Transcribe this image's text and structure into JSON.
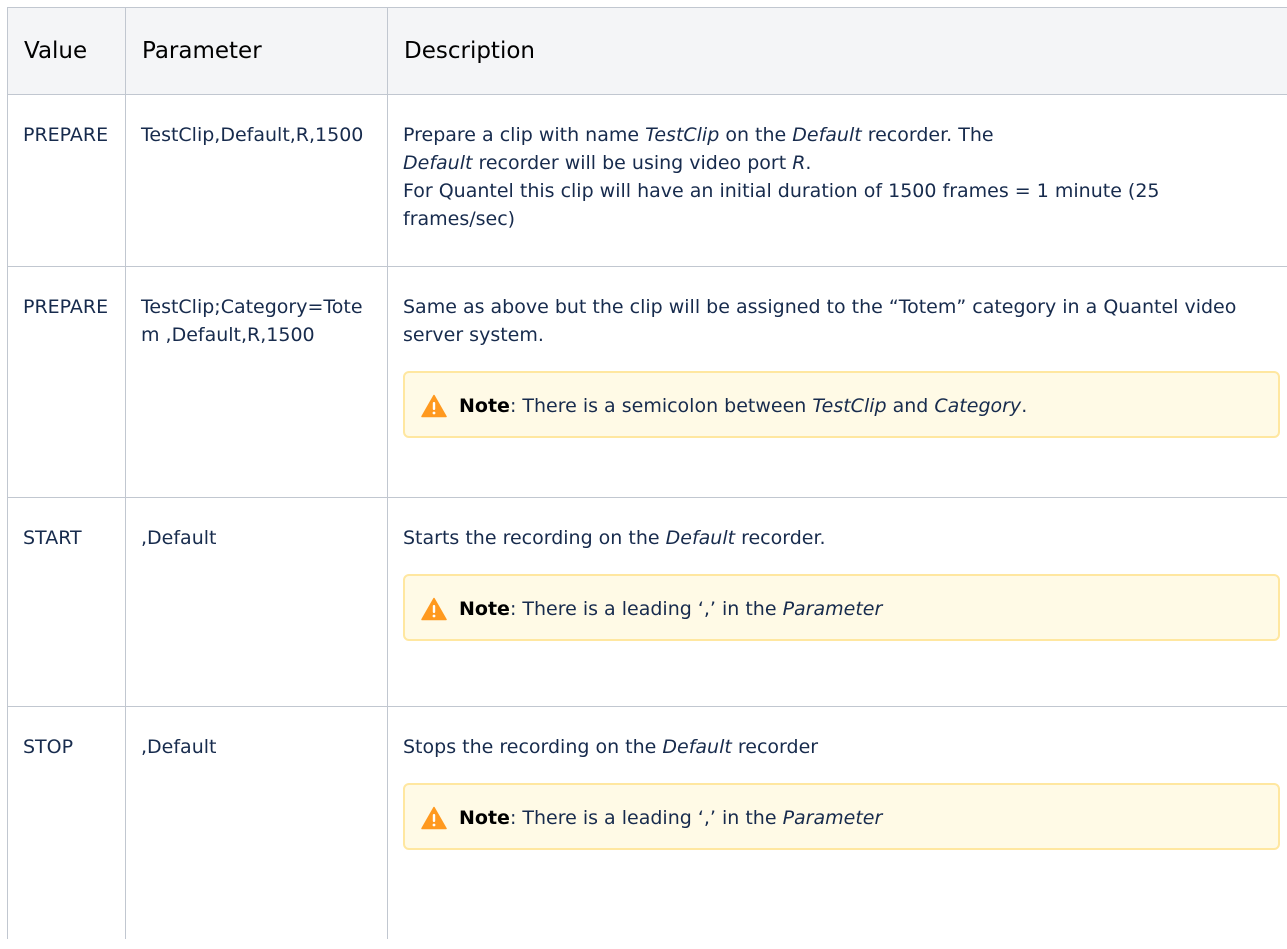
{
  "table": {
    "headers": {
      "value": "Value",
      "parameter": "Parameter",
      "description": "Description"
    },
    "rows": [
      {
        "value": "PREPARE",
        "parameter": "TestClip,Default,R,1500",
        "desc": {
          "a1": "Prepare a clip with name ",
          "a2": "TestClip",
          "a3": " on the ",
          "a4": "Default",
          "a5": " recorder. The",
          "b1": "Default",
          "b2": " recorder will be using video port ",
          "b3": "R",
          "b4": ".",
          "c1": "For Quantel this clip will have an initial duration of 1500 frames = 1 minute (25 frames/sec)"
        }
      },
      {
        "value": "PREPARE",
        "parameter": "TestClip;Category=Totem ,Default,R,1500",
        "desc": {
          "a1": "Same as above but the clip will be assigned to the “Totem” category in a Quantel video server system."
        },
        "note": {
          "label": "Note",
          "t1": ": There is a semicolon between ",
          "t2": "TestClip",
          "t3": " and ",
          "t4": "Category",
          "t5": "."
        }
      },
      {
        "value": "START",
        "parameter": ",Default",
        "desc": {
          "a1": "Starts the recording on the ",
          "a2": "Default",
          "a3": " recorder."
        },
        "note": {
          "label": "Note",
          "t1": ": There is a leading ‘,’ in the ",
          "t2": "Parameter"
        }
      },
      {
        "value": "STOP",
        "parameter": ",Default",
        "desc": {
          "a1": "Stops the recording on the ",
          "a2": "Default",
          "a3": " recorder"
        },
        "note": {
          "label": "Note",
          "t1": ": There is a leading ‘,’ in the ",
          "t2": "Parameter"
        }
      }
    ]
  },
  "icons": {
    "note_icon": "warning-triangle-icon",
    "note_icon_color": "#ff991f"
  },
  "colors": {
    "header_bg": "#f4f5f7",
    "border": "#c1c7d0",
    "note_bg": "#fffae6",
    "note_border": "#ffe7a0"
  }
}
